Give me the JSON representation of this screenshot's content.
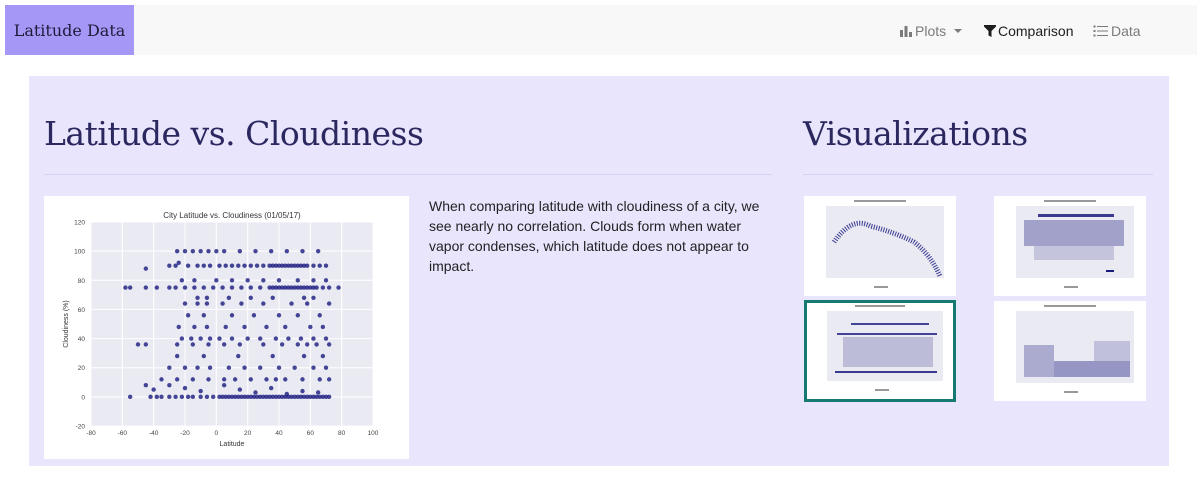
{
  "navbar": {
    "brand": "Latitude Data",
    "items": [
      {
        "label": "Plots",
        "icon": "bar-chart-icon",
        "dropdown": true,
        "active": false
      },
      {
        "label": "Comparison",
        "icon": "filter-icon",
        "active": true
      },
      {
        "label": "Data",
        "icon": "list-icon",
        "active": false
      }
    ]
  },
  "main": {
    "title": "Latitude vs. Cloudiness",
    "description": "When comparing latitude with cloudiness of a city, we see nearly no correlation. Clouds form when water vapor condenses, which latitude does not appear to impact."
  },
  "sidebar": {
    "title": "Visualizations",
    "selected_index": 2
  },
  "colors": {
    "brand_bg": "#a597f5",
    "panel_bg": "#e9e5fd",
    "heading": "#2b2860",
    "point": "#1a1a80",
    "plot_bg": "#eaeaf2",
    "selected_border": "#147a72"
  },
  "chart_data": {
    "type": "scatter",
    "title": "City Latitude vs. Cloudiness (01/05/17)",
    "xlabel": "Latitude",
    "ylabel": "Cloudiness (%)",
    "xlim": [
      -80,
      100
    ],
    "ylim": [
      -20,
      120
    ],
    "xticks": [
      -80,
      -60,
      -40,
      -20,
      0,
      20,
      40,
      60,
      80,
      100
    ],
    "yticks": [
      -20,
      0,
      20,
      40,
      60,
      80,
      100,
      120
    ],
    "grid": true,
    "points": [
      [
        -55,
        0
      ],
      [
        -42,
        0
      ],
      [
        -38,
        0
      ],
      [
        -35,
        0
      ],
      [
        -30,
        0
      ],
      [
        -26,
        0
      ],
      [
        -22,
        0
      ],
      [
        -18,
        0
      ],
      [
        -15,
        0
      ],
      [
        -10,
        0
      ],
      [
        -6,
        0
      ],
      [
        -2,
        0
      ],
      [
        2,
        0
      ],
      [
        4,
        0
      ],
      [
        6,
        0
      ],
      [
        8,
        0
      ],
      [
        10,
        0
      ],
      [
        12,
        0
      ],
      [
        14,
        0
      ],
      [
        16,
        0
      ],
      [
        18,
        0
      ],
      [
        20,
        0
      ],
      [
        22,
        0
      ],
      [
        24,
        0
      ],
      [
        26,
        0
      ],
      [
        28,
        0
      ],
      [
        30,
        0
      ],
      [
        32,
        0
      ],
      [
        34,
        0
      ],
      [
        36,
        0
      ],
      [
        38,
        0
      ],
      [
        40,
        0
      ],
      [
        42,
        0
      ],
      [
        44,
        0
      ],
      [
        46,
        0
      ],
      [
        48,
        0
      ],
      [
        50,
        0
      ],
      [
        52,
        0
      ],
      [
        54,
        0
      ],
      [
        56,
        0
      ],
      [
        58,
        0
      ],
      [
        60,
        0
      ],
      [
        62,
        0
      ],
      [
        64,
        0
      ],
      [
        66,
        0
      ],
      [
        68,
        0
      ],
      [
        70,
        0
      ],
      [
        72,
        0
      ],
      [
        -45,
        8
      ],
      [
        -40,
        5
      ],
      [
        -30,
        8
      ],
      [
        -20,
        6
      ],
      [
        -10,
        4
      ],
      [
        5,
        8
      ],
      [
        15,
        5
      ],
      [
        25,
        3
      ],
      [
        35,
        6
      ],
      [
        45,
        2
      ],
      [
        55,
        4
      ],
      [
        65,
        3
      ],
      [
        -35,
        12
      ],
      [
        -25,
        12
      ],
      [
        -15,
        12
      ],
      [
        -5,
        12
      ],
      [
        5,
        12
      ],
      [
        12,
        12
      ],
      [
        22,
        12
      ],
      [
        32,
        12
      ],
      [
        38,
        12
      ],
      [
        44,
        12
      ],
      [
        55,
        12
      ],
      [
        66,
        12
      ],
      [
        72,
        12
      ],
      [
        -30,
        20
      ],
      [
        -20,
        20
      ],
      [
        -12,
        20
      ],
      [
        -4,
        20
      ],
      [
        8,
        20
      ],
      [
        18,
        20
      ],
      [
        28,
        20
      ],
      [
        40,
        20
      ],
      [
        50,
        20
      ],
      [
        62,
        20
      ],
      [
        70,
        20
      ],
      [
        -25,
        28
      ],
      [
        -8,
        28
      ],
      [
        14,
        28
      ],
      [
        36,
        28
      ],
      [
        56,
        28
      ],
      [
        68,
        28
      ],
      [
        -50,
        36
      ],
      [
        -45,
        36
      ],
      [
        -25,
        36
      ],
      [
        -15,
        36
      ],
      [
        -5,
        36
      ],
      [
        5,
        36
      ],
      [
        15,
        36
      ],
      [
        30,
        36
      ],
      [
        42,
        36
      ],
      [
        52,
        36
      ],
      [
        58,
        36
      ],
      [
        64,
        36
      ],
      [
        72,
        36
      ],
      [
        -22,
        40
      ],
      [
        -16,
        40
      ],
      [
        -10,
        40
      ],
      [
        -4,
        40
      ],
      [
        2,
        40
      ],
      [
        10,
        40
      ],
      [
        20,
        40
      ],
      [
        28,
        40
      ],
      [
        38,
        40
      ],
      [
        46,
        40
      ],
      [
        54,
        40
      ],
      [
        62,
        40
      ],
      [
        70,
        40
      ],
      [
        -24,
        48
      ],
      [
        -14,
        48
      ],
      [
        -6,
        48
      ],
      [
        6,
        48
      ],
      [
        18,
        48
      ],
      [
        32,
        48
      ],
      [
        44,
        48
      ],
      [
        60,
        48
      ],
      [
        68,
        48
      ],
      [
        -18,
        56
      ],
      [
        -8,
        56
      ],
      [
        10,
        56
      ],
      [
        24,
        56
      ],
      [
        40,
        56
      ],
      [
        52,
        56
      ],
      [
        66,
        56
      ],
      [
        -20,
        64
      ],
      [
        -12,
        64
      ],
      [
        -6,
        64
      ],
      [
        4,
        64
      ],
      [
        16,
        64
      ],
      [
        30,
        64
      ],
      [
        48,
        64
      ],
      [
        58,
        64
      ],
      [
        72,
        64
      ],
      [
        -12,
        68
      ],
      [
        -6,
        68
      ],
      [
        8,
        68
      ],
      [
        22,
        68
      ],
      [
        36,
        68
      ],
      [
        56,
        68
      ],
      [
        62,
        68
      ],
      [
        -58,
        75
      ],
      [
        -55,
        75
      ],
      [
        -45,
        75
      ],
      [
        -38,
        75
      ],
      [
        -30,
        75
      ],
      [
        -26,
        75
      ],
      [
        -20,
        75
      ],
      [
        -14,
        75
      ],
      [
        -8,
        75
      ],
      [
        -2,
        75
      ],
      [
        4,
        75
      ],
      [
        10,
        75
      ],
      [
        16,
        75
      ],
      [
        22,
        75
      ],
      [
        28,
        75
      ],
      [
        34,
        75
      ],
      [
        36,
        75
      ],
      [
        38,
        75
      ],
      [
        40,
        75
      ],
      [
        42,
        75
      ],
      [
        44,
        75
      ],
      [
        46,
        75
      ],
      [
        48,
        75
      ],
      [
        50,
        75
      ],
      [
        52,
        75
      ],
      [
        54,
        75
      ],
      [
        56,
        75
      ],
      [
        58,
        75
      ],
      [
        60,
        75
      ],
      [
        62,
        75
      ],
      [
        64,
        75
      ],
      [
        68,
        75
      ],
      [
        72,
        75
      ],
      [
        78,
        75
      ],
      [
        -22,
        80
      ],
      [
        -14,
        80
      ],
      [
        0,
        80
      ],
      [
        10,
        80
      ],
      [
        20,
        80
      ],
      [
        30,
        80
      ],
      [
        40,
        80
      ],
      [
        52,
        80
      ],
      [
        62,
        80
      ],
      [
        70,
        80
      ],
      [
        -45,
        88
      ],
      [
        -30,
        90
      ],
      [
        -26,
        90
      ],
      [
        -24,
        92
      ],
      [
        -18,
        90
      ],
      [
        -12,
        90
      ],
      [
        -8,
        90
      ],
      [
        -4,
        90
      ],
      [
        2,
        90
      ],
      [
        6,
        90
      ],
      [
        10,
        90
      ],
      [
        14,
        90
      ],
      [
        18,
        90
      ],
      [
        22,
        90
      ],
      [
        26,
        90
      ],
      [
        30,
        90
      ],
      [
        34,
        90
      ],
      [
        36,
        90
      ],
      [
        38,
        90
      ],
      [
        40,
        90
      ],
      [
        42,
        90
      ],
      [
        44,
        90
      ],
      [
        46,
        90
      ],
      [
        48,
        90
      ],
      [
        50,
        90
      ],
      [
        52,
        90
      ],
      [
        54,
        90
      ],
      [
        56,
        90
      ],
      [
        58,
        90
      ],
      [
        62,
        90
      ],
      [
        66,
        90
      ],
      [
        70,
        90
      ],
      [
        -25,
        100
      ],
      [
        -20,
        100
      ],
      [
        -15,
        100
      ],
      [
        -10,
        100
      ],
      [
        -5,
        100
      ],
      [
        0,
        100
      ],
      [
        5,
        100
      ],
      [
        15,
        100
      ],
      [
        25,
        100
      ],
      [
        35,
        100
      ],
      [
        45,
        100
      ],
      [
        55,
        100
      ],
      [
        65,
        100
      ]
    ]
  }
}
